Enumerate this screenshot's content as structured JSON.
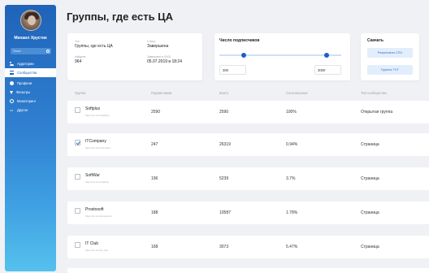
{
  "sidebar": {
    "user_name": "Михаил Хрустик",
    "search_placeholder": "Поиск",
    "items": [
      {
        "label": "Аудитории",
        "icon": "users-icon"
      },
      {
        "label": "Сообщества",
        "icon": "list-icon"
      },
      {
        "label": "Профили",
        "icon": "person-icon"
      },
      {
        "label": "Фильтры",
        "icon": "filter-icon"
      },
      {
        "label": "Мониторинг",
        "icon": "eye-icon"
      },
      {
        "label": "Другое",
        "icon": "dots-icon"
      }
    ],
    "active_item": "Сообщества",
    "colors": {
      "top": "#1f63b8",
      "bottom": "#55c1ee"
    }
  },
  "page": {
    "title": "Группы, где есть ЦА"
  },
  "info": {
    "name_label": "Тип",
    "name_value": "Группы, где есть ЦА",
    "status_label": "Статус",
    "status_value": "Завершена",
    "count_label": "Найдено",
    "count_value": "964",
    "date_label": "Завершено в 00:00",
    "date_value": "05.07.2019 в 18:24"
  },
  "subscribers": {
    "title": "Число подписчиков",
    "min_value": "300",
    "max_value": "3000",
    "range_low_fraction": 0.2,
    "range_high_fraction": 0.88
  },
  "download": {
    "title": "Скачать",
    "csv_label": "Результаты CSV",
    "txt_label": "Группы TXT",
    "accent": "#2f6ecb"
  },
  "table": {
    "headers": [
      "Группа",
      "Подписчиков",
      "Всего",
      "Соотношение",
      "Тип сообщества"
    ],
    "rows": [
      {
        "name": "Softplus",
        "url": "https://vk.com/softplus",
        "subscribers": "2590",
        "total": "2590",
        "ratio": "100%",
        "type": "Открытая группа",
        "checked": false
      },
      {
        "name": "ITCompany",
        "url": "https://vk.com/company",
        "subscribers": "247",
        "total": "26319",
        "ratio": "0.94%",
        "type": "Страница",
        "checked": true
      },
      {
        "name": "SoftWar",
        "url": "https://vk.com/softwar",
        "subscribers": "196",
        "total": "5239",
        "ratio": "3.7%",
        "type": "Страница",
        "checked": false
      },
      {
        "name": "Prostosoft",
        "url": "https://vk.com/prostosoft",
        "subscribers": "188",
        "total": "10587",
        "ratio": "1.78%",
        "type": "Страница",
        "checked": false
      },
      {
        "name": "IT Club",
        "url": "https://vk.com/it_club",
        "subscribers": "168",
        "total": "3073",
        "ratio": "5.47%",
        "type": "Страница",
        "checked": false
      }
    ]
  }
}
